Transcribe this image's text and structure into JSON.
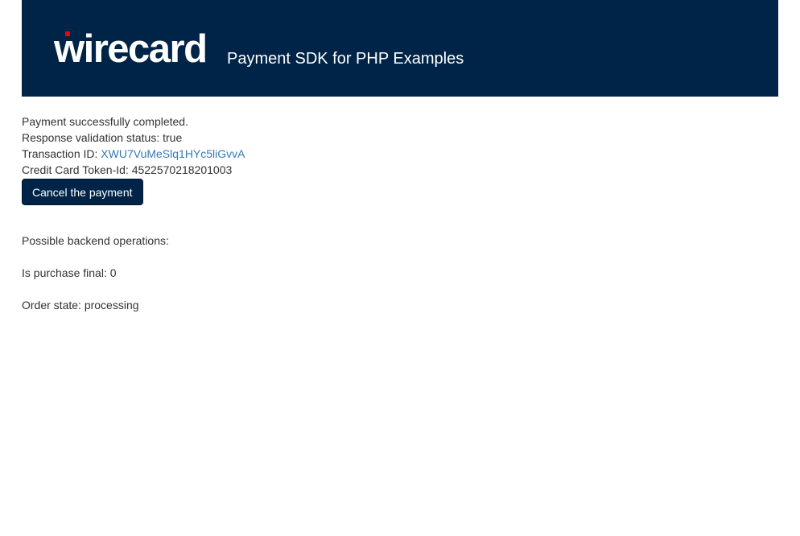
{
  "header": {
    "logo_text": "wirecard",
    "subtitle": "Payment SDK for PHP Examples",
    "background_color": "#002447",
    "accent_color": "#e30613"
  },
  "result": {
    "status_message": "Payment successfully completed.",
    "validation_label": "Response validation status: ",
    "validation_value": "true",
    "transaction_label": "Transaction ID: ",
    "transaction_id": "XWU7VuMeSlq1HYc5liGvvA",
    "token_label": "Credit Card Token-Id: ",
    "token_value": "4522570218201003"
  },
  "actions": {
    "cancel_label": "Cancel the payment"
  },
  "backend": {
    "operations_label": "Possible backend operations:",
    "purchase_final_label": "Is purchase final: ",
    "purchase_final_value": "0",
    "order_state_label": "Order state: ",
    "order_state_value": "processing"
  }
}
